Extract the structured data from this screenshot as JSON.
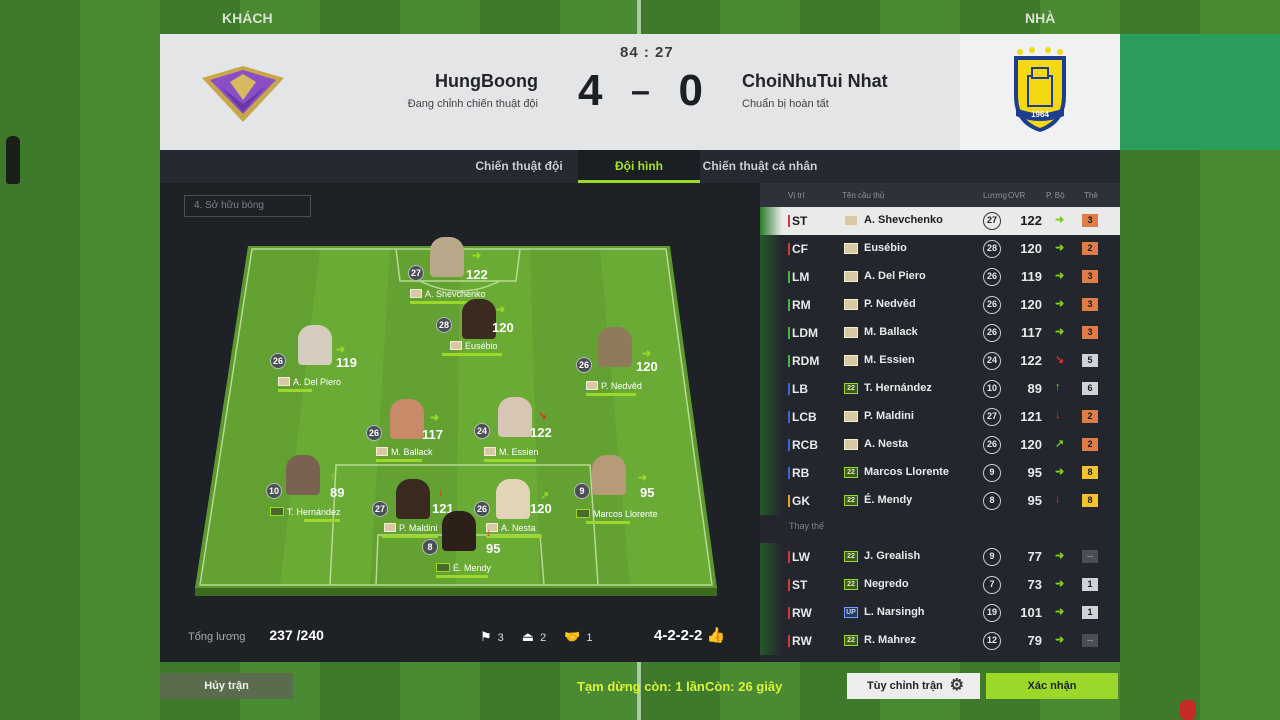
{
  "side_labels": {
    "away": "KHÁCH",
    "home": "NHÀ"
  },
  "match": {
    "clock": "84 : 27",
    "away": {
      "name": "HungBoong",
      "status": "Đang chỉnh chiến thuật đội",
      "score": "4"
    },
    "home": {
      "name": "ChoiNhuTui Nhat",
      "status": "Chuẩn bị hoàn tất",
      "score": "0"
    },
    "separator": "–",
    "home_crest_year": "1964"
  },
  "tabs": [
    {
      "label": "Chiến thuật đội",
      "active": false
    },
    {
      "label": "Đội hình",
      "active": true
    },
    {
      "label": "Chiến thuật cá nhân",
      "active": false
    }
  ],
  "filter": {
    "label": "4. Sở hữu bóng"
  },
  "field_players": [
    {
      "id": "st",
      "name": "A. Shevchenko",
      "ovr": "122",
      "level": "27",
      "season": "icon",
      "arrow": "➜"
    },
    {
      "id": "cf",
      "name": "Eusébio",
      "ovr": "120",
      "level": "28",
      "season": "icon",
      "arrow": "➜"
    },
    {
      "id": "lm",
      "name": "A. Del Piero",
      "ovr": "119",
      "level": "26",
      "season": "icon",
      "arrow": "➜"
    },
    {
      "id": "rm",
      "name": "P. Nedvěd",
      "ovr": "120",
      "level": "26",
      "season": "icon",
      "arrow": "➜"
    },
    {
      "id": "ldm",
      "name": "M. Ballack",
      "ovr": "117",
      "level": "26",
      "season": "icon",
      "arrow": "➜"
    },
    {
      "id": "rdm",
      "name": "M. Essien",
      "ovr": "122",
      "level": "24",
      "season": "icon",
      "arrow": "↘"
    },
    {
      "id": "lb",
      "name": "T. Hernández",
      "ovr": "89",
      "level": "10",
      "season": "22",
      "arrow": "↑"
    },
    {
      "id": "lcb",
      "name": "P. Maldini",
      "ovr": "121",
      "level": "27",
      "season": "icon",
      "arrow": "↓"
    },
    {
      "id": "rcb",
      "name": "A. Nesta",
      "ovr": "120",
      "level": "26",
      "season": "icon",
      "arrow": "↗"
    },
    {
      "id": "rb",
      "name": "Marcos Llorente",
      "ovr": "95",
      "level": "9",
      "season": "22",
      "arrow": "➜"
    },
    {
      "id": "gk",
      "name": "É. Mendy",
      "ovr": "95",
      "level": "8",
      "season": "22",
      "arrow": "↓"
    }
  ],
  "salary": {
    "label": "Tổng lương",
    "value": "237 /240"
  },
  "stats": [
    {
      "icon": "flag-icon",
      "value": "3"
    },
    {
      "icon": "upgrade-icon",
      "value": "2"
    },
    {
      "icon": "handshake-icon",
      "value": "1"
    }
  ],
  "formation": "4-2-2-2",
  "table": {
    "headers": {
      "pos": "Vị trí",
      "name": "Tên cầu thủ",
      "salary": "Lương",
      "ovr": "OVR",
      "form": "P. Bộ",
      "card": "Thẻ"
    },
    "starters": [
      {
        "pos": "ST",
        "name": "A. Shevchenko",
        "season": "icon",
        "lv": "27",
        "ovr": "122",
        "form": "➜",
        "card": "3",
        "card_color": "#e07b4a",
        "pos_color": "#d43a3a",
        "form_color": "#7ccb22"
      },
      {
        "pos": "CF",
        "name": "Eusébio",
        "season": "icon",
        "lv": "28",
        "ovr": "120",
        "form": "➜",
        "card": "2",
        "card_color": "#e07b4a",
        "pos_color": "#d43a3a",
        "form_color": "#7ccb22"
      },
      {
        "pos": "LM",
        "name": "A. Del Piero",
        "season": "icon",
        "lv": "26",
        "ovr": "119",
        "form": "➜",
        "card": "3",
        "card_color": "#e07b4a",
        "pos_color": "#3fb83f",
        "form_color": "#7ccb22"
      },
      {
        "pos": "RM",
        "name": "P. Nedvěd",
        "season": "icon",
        "lv": "26",
        "ovr": "120",
        "form": "➜",
        "card": "3",
        "card_color": "#e07b4a",
        "pos_color": "#3fb83f",
        "form_color": "#7ccb22"
      },
      {
        "pos": "LDM",
        "name": "M. Ballack",
        "season": "icon",
        "lv": "26",
        "ovr": "117",
        "form": "➜",
        "card": "3",
        "card_color": "#e07b4a",
        "pos_color": "#3fb83f",
        "form_color": "#7ccb22"
      },
      {
        "pos": "RDM",
        "name": "M. Essien",
        "season": "icon",
        "lv": "24",
        "ovr": "122",
        "form": "↘",
        "card": "5",
        "card_color": "#cfd3d7",
        "pos_color": "#3fb83f",
        "form_color": "#e03030"
      },
      {
        "pos": "LB",
        "name": "T. Hernández",
        "season": "22",
        "lv": "10",
        "ovr": "89",
        "form": "↑",
        "card": "6",
        "card_color": "#cfd3d7",
        "pos_color": "#3a68d8",
        "form_color": "#7ccb22"
      },
      {
        "pos": "LCB",
        "name": "P. Maldini",
        "season": "icon",
        "lv": "27",
        "ovr": "121",
        "form": "↓",
        "card": "2",
        "card_color": "#e07b4a",
        "pos_color": "#3a68d8",
        "form_color": "#e03030"
      },
      {
        "pos": "RCB",
        "name": "A. Nesta",
        "season": "icon",
        "lv": "26",
        "ovr": "120",
        "form": "↗",
        "card": "2",
        "card_color": "#e07b4a",
        "pos_color": "#3a68d8",
        "form_color": "#7ccb22"
      },
      {
        "pos": "RB",
        "name": "Marcos Llorente",
        "season": "22",
        "lv": "9",
        "ovr": "95",
        "form": "➜",
        "card": "8",
        "card_color": "#f2c230",
        "pos_color": "#3a68d8",
        "form_color": "#7ccb22"
      },
      {
        "pos": "GK",
        "name": "É. Mendy",
        "season": "22",
        "lv": "8",
        "ovr": "95",
        "form": "↓",
        "card": "8",
        "card_color": "#f2c230",
        "pos_color": "#e6a01f",
        "form_color": "#e03030"
      }
    ],
    "subs_label": "Thay thế",
    "subs": [
      {
        "pos": "LW",
        "name": "J. Grealish",
        "season": "22",
        "lv": "9",
        "ovr": "77",
        "form": "➜",
        "card": "--",
        "card_color": "#4a4f55",
        "pos_color": "#d43a3a",
        "form_color": "#7ccb22"
      },
      {
        "pos": "ST",
        "name": "Negredo",
        "season": "22",
        "lv": "7",
        "ovr": "73",
        "form": "➜",
        "card": "1",
        "card_color": "#cfd3d7",
        "pos_color": "#d43a3a",
        "form_color": "#7ccb22"
      },
      {
        "pos": "RW",
        "name": "L. Narsingh",
        "season": "UP",
        "lv": "19",
        "ovr": "101",
        "form": "➜",
        "card": "1",
        "card_color": "#cfd3d7",
        "pos_color": "#d43a3a",
        "form_color": "#7ccb22"
      },
      {
        "pos": "RW",
        "name": "R. Mahrez",
        "season": "22",
        "lv": "12",
        "ovr": "79",
        "form": "➜",
        "card": "--",
        "card_color": "#4a4f55",
        "pos_color": "#d43a3a",
        "form_color": "#7ccb22"
      }
    ]
  },
  "bottom": {
    "quit": "Hủy trận",
    "pause": "Tạm dừng còn: 1 lần",
    "time": "Còn: 26 giây",
    "adjust": "Tùy chỉnh trận",
    "confirm": "Xác nhận"
  }
}
